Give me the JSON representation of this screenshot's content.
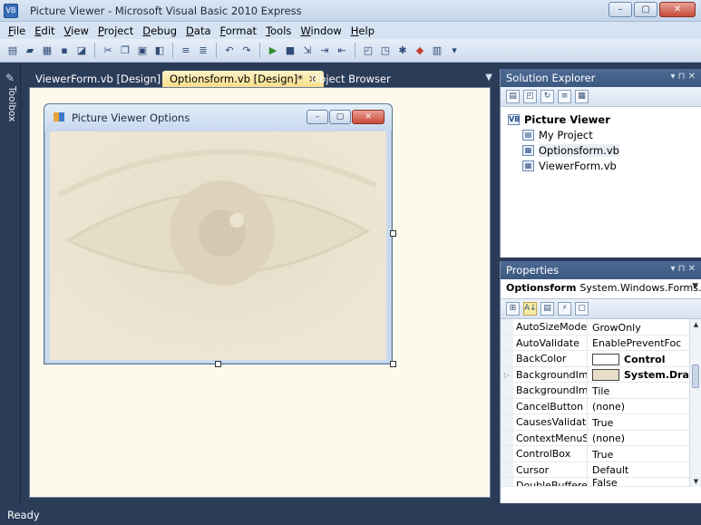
{
  "window": {
    "title": "Picture Viewer - Microsoft Visual Basic 2010 Express",
    "controls": [
      "–",
      "▢",
      "✕"
    ]
  },
  "menu": [
    "File",
    "Edit",
    "View",
    "Project",
    "Debug",
    "Data",
    "Format",
    "Tools",
    "Window",
    "Help"
  ],
  "toolbox": {
    "label": "Toolbox"
  },
  "tabs": [
    {
      "label": "ViewerForm.vb [Design]"
    },
    {
      "label": "Optionsform.vb [Design]*",
      "close": "✕"
    },
    {
      "label": "Object Browser"
    }
  ],
  "tabs_menu_glyph": "▼",
  "form": {
    "title": "Picture Viewer Options",
    "controls": [
      "–",
      "▢",
      "✕"
    ]
  },
  "solution_explorer": {
    "title": "Solution Explorer",
    "pane_controls": "▾ ⊓ ✕",
    "items": [
      {
        "label": "Picture Viewer",
        "icon": "solution-icon"
      },
      {
        "label": "My Project",
        "icon": "project-properties-icon"
      },
      {
        "label": "Optionsform.vb",
        "icon": "form-file-icon"
      },
      {
        "label": "ViewerForm.vb",
        "icon": "form-file-icon"
      }
    ]
  },
  "properties": {
    "title": "Properties",
    "pane_controls": "▾ ⊓ ✕",
    "object_name": "Optionsform",
    "object_type": "System.Windows.Forms.I",
    "rows": [
      {
        "name": "AutoSizeMode",
        "value": "GrowOnly"
      },
      {
        "name": "AutoValidate",
        "value": "EnablePreventFoc"
      },
      {
        "name": "BackColor",
        "value": "Control",
        "swatch": "#ffffff",
        "bold": true
      },
      {
        "name": "BackgroundIma",
        "value": "System.Drav",
        "swatch": "#e9dfc8",
        "bold": true,
        "expander": "▷"
      },
      {
        "name": "BackgroundIma",
        "value": "Tile"
      },
      {
        "name": "CancelButton",
        "value": "(none)"
      },
      {
        "name": "CausesValidatio",
        "value": "True"
      },
      {
        "name": "ContextMenuSti",
        "value": "(none)"
      },
      {
        "name": "ControlBox",
        "value": "True"
      },
      {
        "name": "Cursor",
        "value": "Default"
      },
      {
        "name": "DoubleBuffered",
        "value": "False"
      }
    ]
  },
  "status": {
    "text": "Ready"
  },
  "colors": {
    "ide_bg": "#2b3c59",
    "active_tab": "#f7dd8a",
    "design_surface": "#fdf9ed"
  }
}
